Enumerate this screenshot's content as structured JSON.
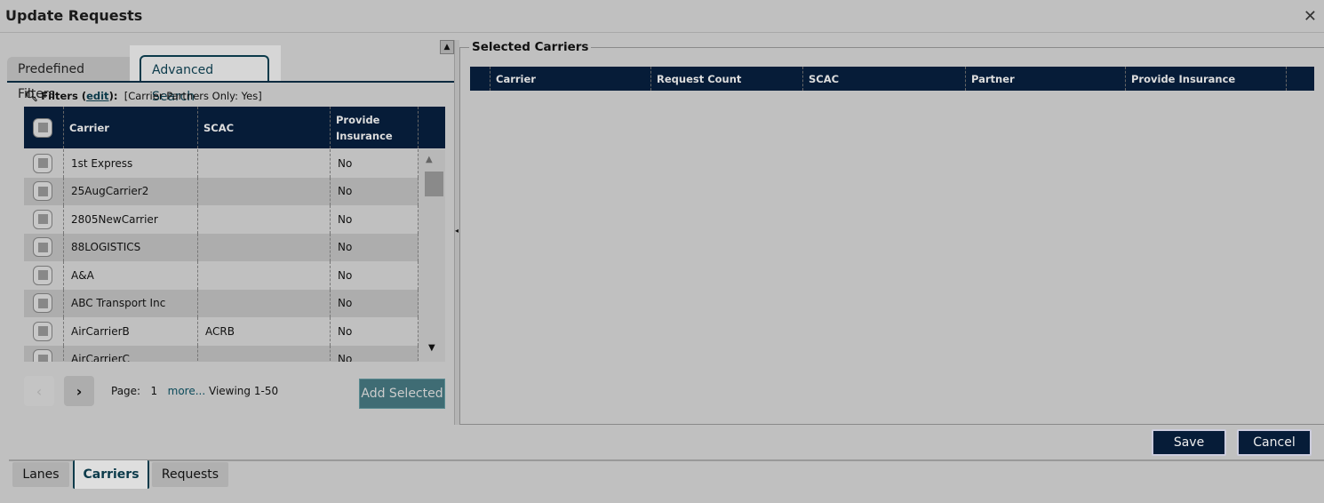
{
  "window": {
    "title": "Update Requests",
    "close_icon": "close-icon"
  },
  "tabs": [
    {
      "label": "Predefined Filters",
      "active": false
    },
    {
      "label": "Advanced Search",
      "active": true
    }
  ],
  "filters": {
    "label": "Filters (",
    "edit": "edit",
    "suffix": "):",
    "value": "[Carrier Partners Only: Yes]"
  },
  "grid": {
    "columns": [
      "Carrier",
      "SCAC",
      "Provide Insurance"
    ],
    "rows": [
      {
        "carrier": "1st Express",
        "scac": "",
        "insurance": "No"
      },
      {
        "carrier": "25AugCarrier2",
        "scac": "",
        "insurance": "No"
      },
      {
        "carrier": "2805NewCarrier",
        "scac": "",
        "insurance": "No"
      },
      {
        "carrier": "88LOGISTICS",
        "scac": "",
        "insurance": "No"
      },
      {
        "carrier": "A&A",
        "scac": "",
        "insurance": "No"
      },
      {
        "carrier": "ABC Transport Inc",
        "scac": "",
        "insurance": "No"
      },
      {
        "carrier": "AirCarrierB",
        "scac": "ACRB",
        "insurance": "No"
      },
      {
        "carrier": "AirCarrierC",
        "scac": "",
        "insurance": "No"
      }
    ]
  },
  "pager": {
    "page_label": "Page:",
    "page": "1",
    "more": "more...",
    "viewing": "Viewing 1-50"
  },
  "add_selected": "Add Selected",
  "selected": {
    "legend": "Selected Carriers",
    "columns": [
      "Carrier",
      "Request Count",
      "SCAC",
      "Partner",
      "Provide Insurance"
    ]
  },
  "actions": {
    "save": "Save",
    "cancel": "Cancel"
  },
  "bottom_tabs": [
    {
      "label": "Lanes",
      "active": false
    },
    {
      "label": "Carriers",
      "active": true
    },
    {
      "label": "Requests",
      "active": false
    }
  ],
  "colors": {
    "header": "#061c38",
    "accent": "#0b3a4a",
    "add_button": "#3f6c74"
  }
}
